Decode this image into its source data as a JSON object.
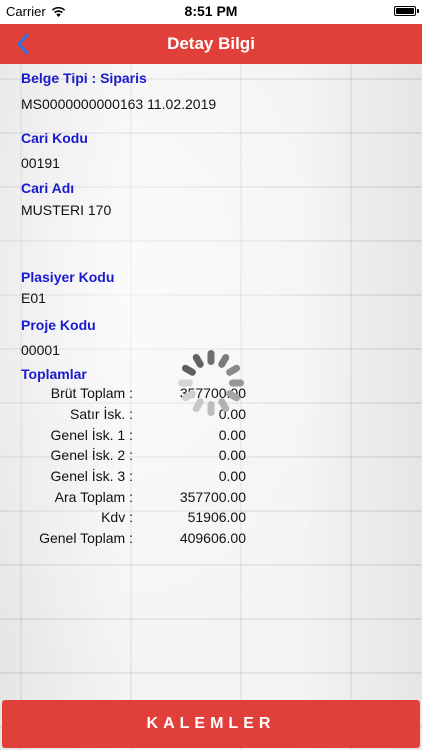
{
  "status_bar": {
    "carrier": "Carrier",
    "time": "8:51 PM"
  },
  "nav": {
    "title": "Detay Bilgi",
    "accent_color": "#e1403a"
  },
  "document": {
    "type_label": "Belge Tipi : Siparis",
    "doc_line": "MS0000000000163 11.02.2019",
    "cari_kodu_label": "Cari Kodu",
    "cari_kodu_value": "00191",
    "cari_adi_label": "Cari Adı",
    "cari_adi_value": "MUSTERI 170",
    "plasiyer_label": "Plasiyer Kodu",
    "plasiyer_value": "E01",
    "proje_label": "Proje Kodu",
    "proje_value": "00001"
  },
  "totals": {
    "heading": "Toplamlar",
    "rows": [
      {
        "label": "Brüt Toplam :",
        "value": "357700.00"
      },
      {
        "label": "Satır İsk. :",
        "value": "0.00"
      },
      {
        "label": "Genel İsk. 1 :",
        "value": "0.00"
      },
      {
        "label": "Genel İsk. 2 :",
        "value": "0.00"
      },
      {
        "label": "Genel İsk. 3 :",
        "value": "0.00"
      },
      {
        "label": "Ara Toplam :",
        "value": "357700.00"
      },
      {
        "label": "Kdv :",
        "value": "51906.00"
      },
      {
        "label": "Genel Toplam :",
        "value": "409606.00"
      }
    ]
  },
  "footer": {
    "button_label": "KALEMLER"
  },
  "icons": {
    "back": "chevron-left-icon",
    "spinner": "loading-spinner-icon",
    "wifi": "wifi-icon",
    "battery": "battery-icon"
  }
}
